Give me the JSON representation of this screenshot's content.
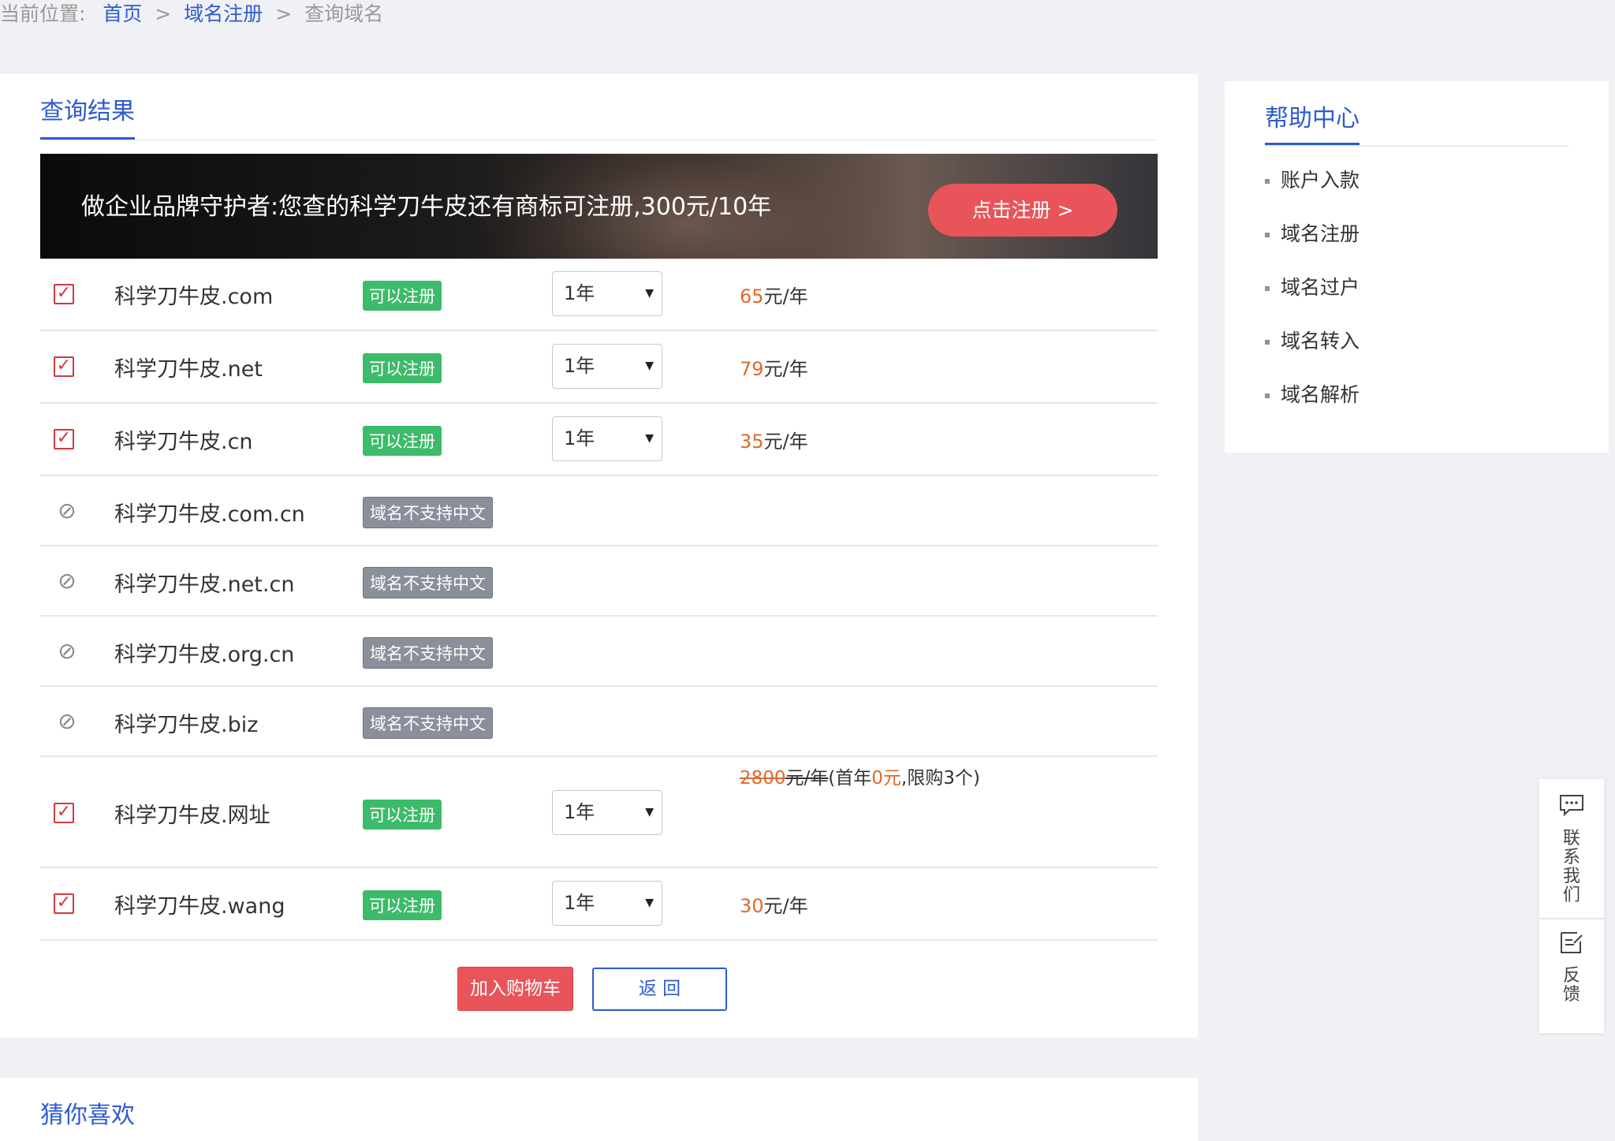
{
  "breadcrumb": {
    "label": "当前位置:",
    "home": "首页",
    "sep1": ">",
    "section": "域名注册",
    "sep2": ">",
    "current": "查询域名"
  },
  "results": {
    "title": "查询结果",
    "banner_text": "做企业品牌守护者:您查的科学刀牛皮还有商标可注册,300元/10年",
    "banner_button": "点击注册 >",
    "rows": [
      {
        "name": "科学刀牛皮.com",
        "status": "可以注册",
        "period": "1年",
        "price": "65",
        "unit": "元/年"
      },
      {
        "name": "科学刀牛皮.net",
        "status": "可以注册",
        "period": "1年",
        "price": "79",
        "unit": "元/年"
      },
      {
        "name": "科学刀牛皮.cn",
        "status": "可以注册",
        "period": "1年",
        "price": "35",
        "unit": "元/年"
      },
      {
        "name": "科学刀牛皮.com.cn",
        "status": "域名不支持中文"
      },
      {
        "name": "科学刀牛皮.net.cn",
        "status": "域名不支持中文"
      },
      {
        "name": "科学刀牛皮.org.cn",
        "status": "域名不支持中文"
      },
      {
        "name": "科学刀牛皮.biz",
        "status": "域名不支持中文"
      },
      {
        "name": "科学刀牛皮.网址",
        "status": "可以注册",
        "period": "1年",
        "promo": {
          "orig_price": "2800",
          "orig_unit": "元/年",
          "open": "(首年",
          "first_year": "0元",
          "rest": ",限购3个)"
        }
      },
      {
        "name": "科学刀牛皮.wang",
        "status": "可以注册",
        "period": "1年",
        "price": "30",
        "unit": "元/年"
      }
    ],
    "add_cart": "加入购物车",
    "back": "返 回"
  },
  "help": {
    "title": "帮助中心",
    "items": [
      "账户入款",
      "域名注册",
      "域名过户",
      "域名转入",
      "域名解析"
    ]
  },
  "float": {
    "contact": "联系我们",
    "feedback": "反馈"
  },
  "guess": {
    "title": "猜你喜欢"
  },
  "colors": {
    "accent": "#2d5bd0",
    "price": "#e06a2c",
    "available": "#3dbb6a",
    "unsupported": "#8a8f9c",
    "cta": "#e8545a"
  },
  "icons": {
    "checked": "checkbox-checked-icon",
    "disabled": "prohibited-icon",
    "chat": "chat-bubble-icon",
    "edit": "edit-note-icon",
    "dropdown": "caret-down-icon"
  }
}
